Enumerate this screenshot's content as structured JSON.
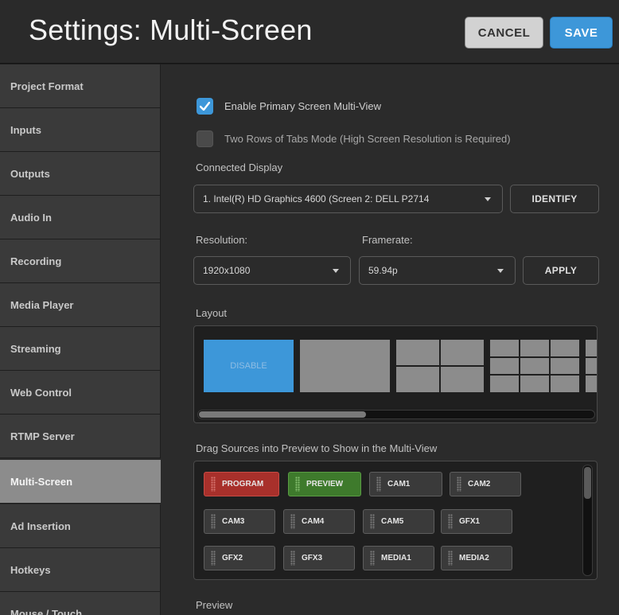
{
  "header": {
    "title": "Settings: Multi-Screen",
    "cancel_label": "CANCEL",
    "save_label": "SAVE"
  },
  "sidebar": {
    "items": [
      {
        "label": "Project Format"
      },
      {
        "label": "Inputs"
      },
      {
        "label": "Outputs"
      },
      {
        "label": "Audio In"
      },
      {
        "label": "Recording"
      },
      {
        "label": "Media Player"
      },
      {
        "label": "Streaming"
      },
      {
        "label": "Web Control"
      },
      {
        "label": "RTMP Server"
      },
      {
        "label": "Multi-Screen",
        "active": true
      },
      {
        "label": "Ad Insertion"
      },
      {
        "label": "Hotkeys"
      },
      {
        "label": "Mouse / Touch"
      }
    ]
  },
  "settings": {
    "enable_primary": {
      "label": "Enable Primary Screen Multi-View",
      "checked": true
    },
    "two_rows": {
      "label": "Two Rows of Tabs Mode (High Screen Resolution is Required)",
      "checked": false
    },
    "connected_display_label": "Connected Display",
    "connected_display_value": "1. Intel(R) HD Graphics 4600 (Screen 2: DELL P2714",
    "identify_label": "IDENTIFY",
    "resolution_label": "Resolution:",
    "resolution_value": "1920x1080",
    "framerate_label": "Framerate:",
    "framerate_value": "59.94p",
    "apply_label": "APPLY",
    "layout_label": "Layout",
    "layout_disable_label": "DISABLE",
    "sources_label": "Drag Sources into Preview to Show in the Multi-View",
    "preview_label": "Preview"
  },
  "sources": {
    "items": [
      {
        "label": "PROGRAM",
        "kind": "program"
      },
      {
        "label": "PREVIEW",
        "kind": "preview"
      },
      {
        "label": "CAM1",
        "kind": "normal"
      },
      {
        "label": "CAM2",
        "kind": "normal"
      },
      {
        "label": "CAM3",
        "kind": "normal"
      },
      {
        "label": "CAM4",
        "kind": "normal"
      },
      {
        "label": "CAM5",
        "kind": "normal"
      },
      {
        "label": "GFX1",
        "kind": "normal"
      },
      {
        "label": "GFX2",
        "kind": "normal"
      },
      {
        "label": "GFX3",
        "kind": "normal"
      },
      {
        "label": "MEDIA1",
        "kind": "normal"
      },
      {
        "label": "MEDIA2",
        "kind": "normal"
      }
    ]
  },
  "colors": {
    "accent": "#3d97d9",
    "program": "#a8302b",
    "preview": "#3e7a2c"
  }
}
